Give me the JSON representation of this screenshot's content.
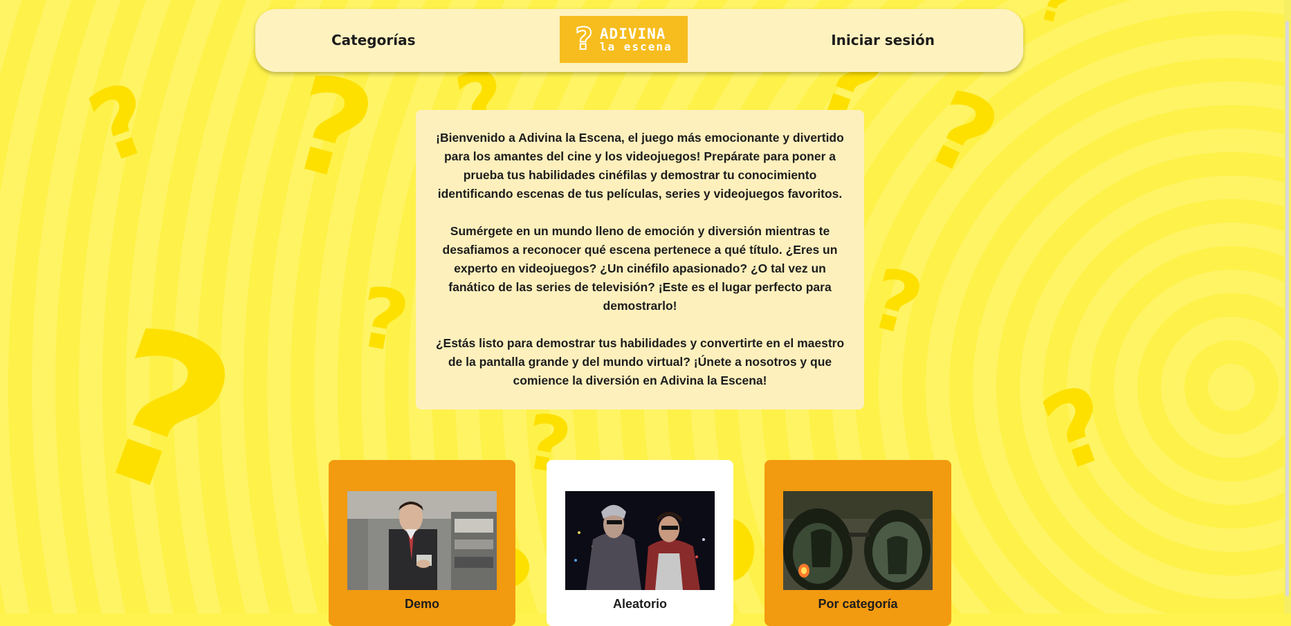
{
  "nav": {
    "categories_label": "Categorías",
    "login_label": "Iniciar sesión",
    "logo": {
      "line1": "ADIVINA",
      "line2": "la escena"
    }
  },
  "welcome": {
    "paragraphs": [
      "¡Bienvenido a Adivina la Escena, el juego más emocionante y divertido para los amantes del cine y los videojuegos! Prepárate para poner a prueba tus habilidades cinéfilas y demostrar tu conocimiento identificando escenas de tus películas, series y videojuegos favoritos.",
      "Sumérgete en un mundo lleno de emoción y diversión mientras te desafiamos a reconocer qué escena pertenece a qué título. ¿Eres un experto en videojuegos? ¿Un cinéfilo apasionado? ¿O tal vez un fanático de las series de televisión? ¡Este es el lugar perfecto para demostrarlo!",
      "¿Estás listo para demostrar tus habilidades y convertirte en el maestro de la pantalla grande y del mundo virtual? ¡Únete a nosotros y que comience la diversión en Adivina la Escena!"
    ]
  },
  "modes": [
    {
      "label": "Demo"
    },
    {
      "label": "Aleatorio"
    },
    {
      "label": "Por categoría"
    }
  ],
  "colors": {
    "background": "#fef34f",
    "panel": "#fdf0bd",
    "card_orange": "#f29a10",
    "card_white": "#ffffff",
    "logo_bg": "#f7bd1f",
    "question_marks": "#fde000"
  },
  "icons": {
    "background_decor": "question-mark-icon"
  }
}
